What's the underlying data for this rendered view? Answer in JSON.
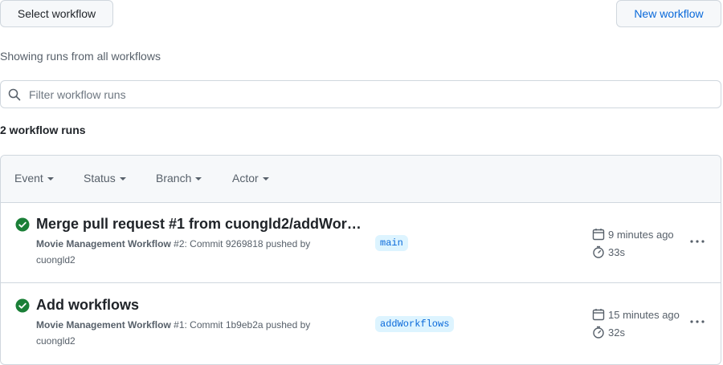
{
  "toolbar": {
    "select_workflow_label": "Select workflow",
    "new_workflow_label": "New workflow"
  },
  "showing_text": "Showing runs from all workflows",
  "search": {
    "placeholder": "Filter workflow runs",
    "value": ""
  },
  "run_count": "2 workflow runs",
  "filters": [
    {
      "label": "Event"
    },
    {
      "label": "Status"
    },
    {
      "label": "Branch"
    },
    {
      "label": "Actor"
    }
  ],
  "runs": [
    {
      "title": "Merge pull request #1 from cuongld2/addWork…",
      "workflow": "Movie Management Workflow",
      "meta": "#2: Commit 9269818 pushed by cuongld2",
      "branch": "main",
      "age": "9 minutes ago",
      "duration": "33s",
      "status": "success"
    },
    {
      "title": "Add workflows",
      "workflow": "Movie Management Workflow",
      "meta": "#1: Commit 1b9eb2a pushed by cuongld2",
      "branch": "addWorkflows",
      "age": "15 minutes ago",
      "duration": "32s",
      "status": "success"
    }
  ],
  "colors": {
    "success": "#1a7f37",
    "link": "#0969da",
    "muted": "#57606a",
    "border": "#d0d7de",
    "branch_bg": "#ddf4ff"
  }
}
